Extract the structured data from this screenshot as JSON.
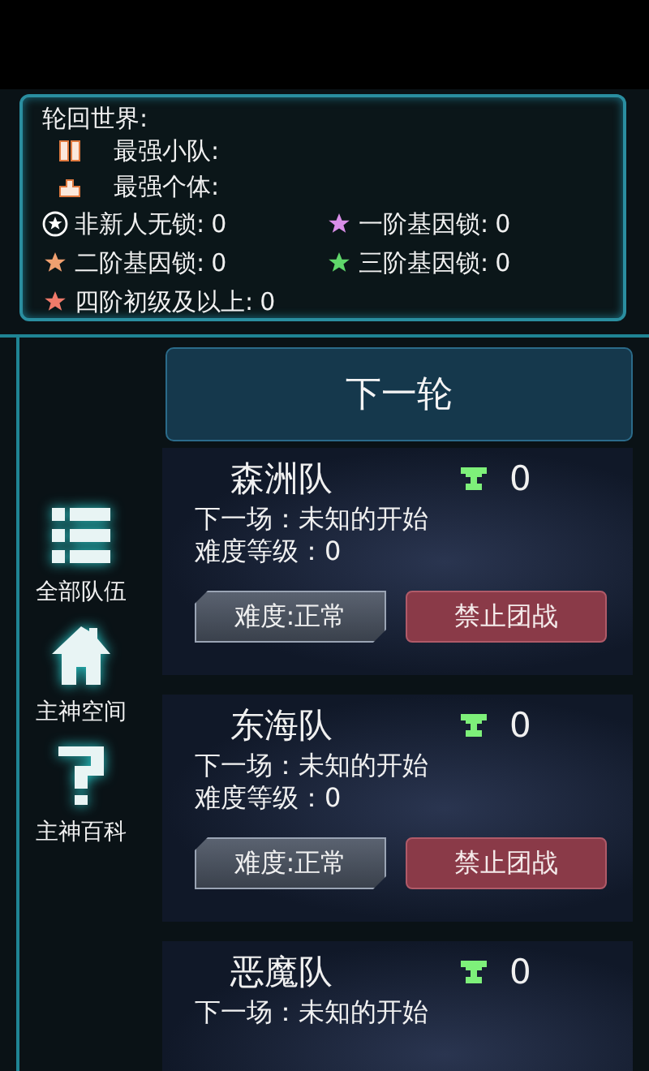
{
  "world_panel": {
    "title": "轮回世界:",
    "rankings": [
      {
        "kind": "squad",
        "label": "最强小队:"
      },
      {
        "kind": "individual",
        "label": "最强个体:"
      }
    ],
    "stats": [
      {
        "kind": "circle-star",
        "label": "非新人无锁:",
        "value": "0",
        "color": "#ffffff"
      },
      {
        "kind": "star",
        "label": "一阶基因锁:",
        "value": "0",
        "color": "#d98ee8"
      },
      {
        "kind": "star",
        "label": "二阶基因锁:",
        "value": "0",
        "color": "#f0a070"
      },
      {
        "kind": "star",
        "label": "三阶基因锁:",
        "value": "0",
        "color": "#5fd66a"
      },
      {
        "kind": "star",
        "label": "四阶初级及以上:",
        "value": "0",
        "color": "#f07a6a"
      }
    ]
  },
  "next_round_button": "下一轮",
  "sidebar": {
    "items": [
      {
        "kind": "list",
        "label": "全部队伍"
      },
      {
        "kind": "home",
        "label": "主神空间"
      },
      {
        "kind": "help",
        "label": "主神百科"
      }
    ]
  },
  "teams": [
    {
      "name": "森洲队",
      "trophies": "0",
      "next_match": "下一场：未知的开始",
      "difficulty_level": "难度等级：0",
      "difficulty_button": "难度:正常",
      "ban_button": "禁止团战"
    },
    {
      "name": "东海队",
      "trophies": "0",
      "next_match": "下一场：未知的开始",
      "difficulty_level": "难度等级：0",
      "difficulty_button": "难度:正常",
      "ban_button": "禁止团战"
    },
    {
      "name": "恶魔队",
      "trophies": "0",
      "next_match": "下一场：未知的开始"
    }
  ]
}
